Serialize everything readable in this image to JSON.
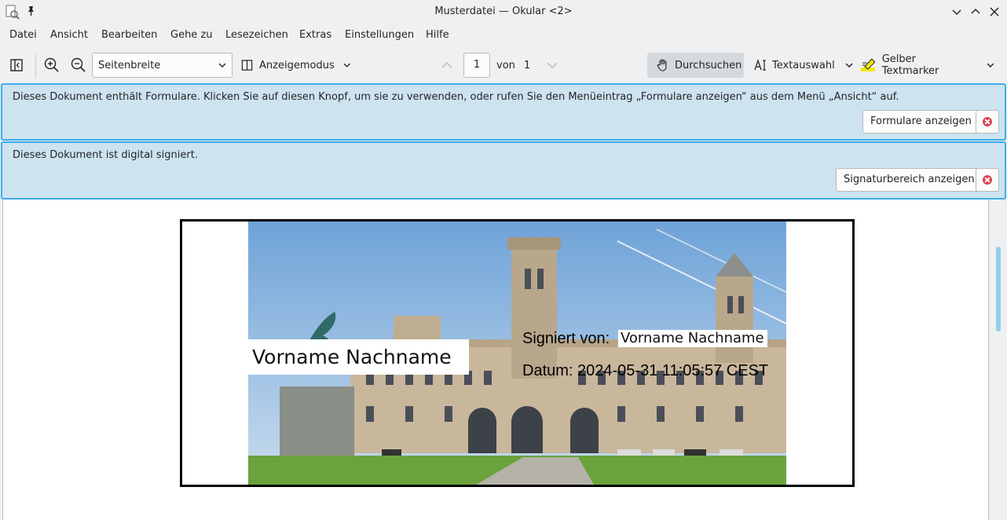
{
  "window": {
    "title": "Musterdatei — Okular <2>"
  },
  "menu": [
    "Datei",
    "Ansicht",
    "Bearbeiten",
    "Gehe zu",
    "Lesezeichen",
    "Extras",
    "Einstellungen",
    "Hilfe"
  ],
  "toolbar": {
    "zoom_mode": "Seitenbreite",
    "view_mode_label": "Anzeigemodus",
    "current_page": "1",
    "page_of_label": "von",
    "total_pages": "1",
    "browse_label": "Durchsuchen",
    "text_select_label": "Textauswahl",
    "highlighter_label": "Gelber Textmarker"
  },
  "banners": {
    "forms": {
      "message": "Dieses Dokument enthält Formulare. Klicken Sie auf diesen Knopf, um sie zu verwenden, oder rufen Sie den Menüeintrag „Formulare anzeigen“ aus dem Menü „Ansicht“ auf.",
      "button": "Formulare anzeigen"
    },
    "signature": {
      "message": "Dieses Dokument ist digital signiert.",
      "button": "Signaturbereich anzeigen"
    }
  },
  "document": {
    "name_field": "Vorname Nachname",
    "signed_by_label": "Signiert von:",
    "signed_by_value": "Vorname Nachname",
    "date_line": "Datum: 2024-05-31 11:05:57 CEST"
  },
  "colors": {
    "accent": "#3daee9",
    "banner_bg": "#cde3ef",
    "close_red": "#da4453"
  }
}
